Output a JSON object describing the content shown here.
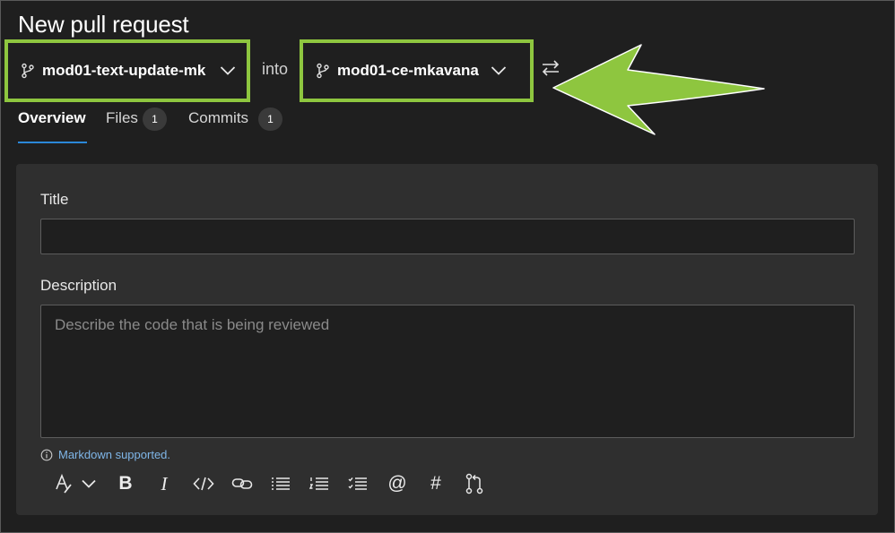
{
  "page": {
    "title": "New pull request"
  },
  "branches": {
    "source": "mod01-text-update-mk",
    "connector": "into",
    "target": "mod01-ce-mkavana"
  },
  "tabs": [
    {
      "label": "Overview",
      "active": true
    },
    {
      "label": "Files",
      "count": "1"
    },
    {
      "label": "Commits",
      "count": "1"
    }
  ],
  "form": {
    "title_label": "Title",
    "title_value": "",
    "description_label": "Description",
    "description_placeholder": "Describe the code that is being reviewed",
    "markdown_note": "Markdown supported."
  },
  "toolbar": {
    "buttons": [
      "format",
      "format-dropdown",
      "bold",
      "italic",
      "code",
      "link",
      "bulleted-list",
      "numbered-list",
      "checklist",
      "mention",
      "work-item",
      "pull-request"
    ],
    "bold_glyph": "B",
    "italic_glyph": "I",
    "mention_glyph": "@",
    "hash_glyph": "#"
  },
  "colors": {
    "background": "#1f1f1f",
    "card": "#2f2f2f",
    "highlight": "#8ec63f",
    "accent_blue": "#2b88d8",
    "link": "#7fb6e8"
  }
}
